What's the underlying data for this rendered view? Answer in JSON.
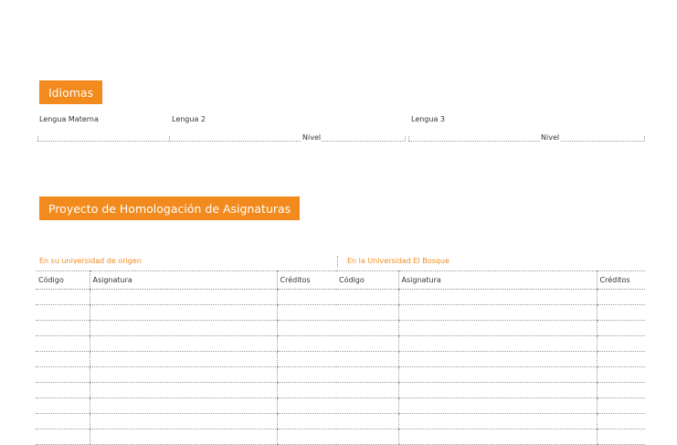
{
  "idiomas": {
    "title": "Idiomas",
    "lengua_materna_label": "Lengua Materna",
    "lengua2_label": "Lengua 2",
    "lengua3_label": "Lengua 3",
    "nivel_label": "Nivel"
  },
  "proyecto": {
    "title": "Proyecto de Homologación de Asignaturas",
    "left_section_label": "En  su universidad de origen",
    "right_section_label": "En la Universidad El Bosque",
    "columns": [
      "Código",
      "Asignatura",
      "Créditos"
    ],
    "row_count": 10
  },
  "colors": {
    "accent": "#f28a1e"
  }
}
